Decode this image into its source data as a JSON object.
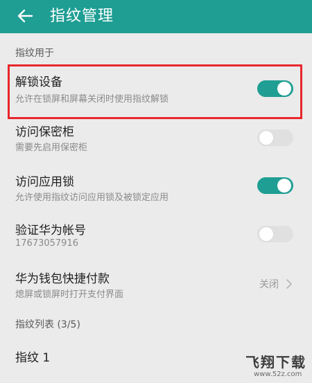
{
  "appbar": {
    "title": "指纹管理",
    "back_icon": "arrow-left-icon",
    "background": "#1f9e93"
  },
  "sections": {
    "usage_header": "指纹用于",
    "list_header": "指纹列表 (3/5)"
  },
  "settings": [
    {
      "title": "解锁设备",
      "subtitle": "允许在锁屏和屏幕关闭时使用指纹解锁",
      "toggle": "on"
    },
    {
      "title": "访问保密柜",
      "subtitle": "需要先启用保密柜",
      "toggle": "off"
    },
    {
      "title": "访问应用锁",
      "subtitle": "允许使用指纹访问应用锁及被锁定应用",
      "toggle": "on"
    },
    {
      "title": "验证华为帐号",
      "subtitle": "17673057916",
      "toggle": "off"
    },
    {
      "title": "华为钱包快捷付款",
      "subtitle": "熄屏或锁屏时打开支付界面",
      "value": "关闭",
      "icon": "chevron-right-icon"
    }
  ],
  "fingerprints": [
    {
      "label": "指纹 1"
    }
  ],
  "colors": {
    "accent": "#1f9e93",
    "highlight": "#e8272c",
    "toggle_off": "#e0e0e0"
  },
  "watermark": {
    "logo": "飞翔下载",
    "url": "www.52z.com"
  }
}
